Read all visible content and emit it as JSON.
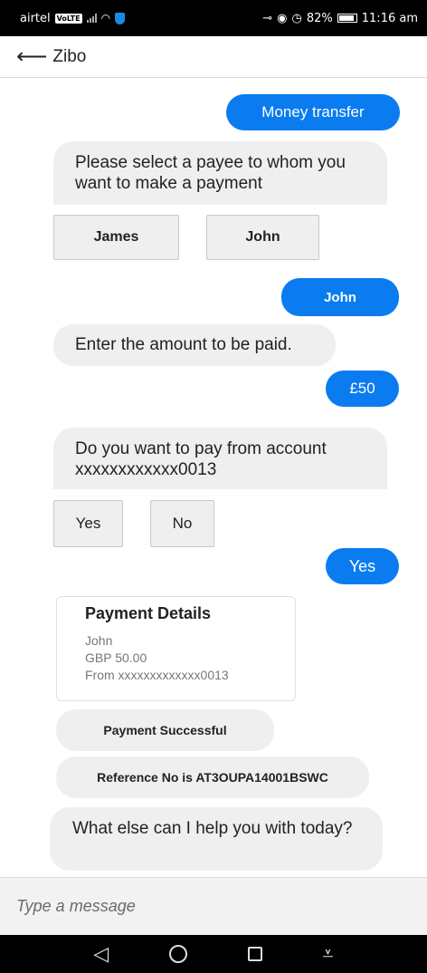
{
  "status_bar": {
    "carrier": "airtel",
    "volte": "VoLTE",
    "battery": "82%",
    "time": "11:16 am"
  },
  "header": {
    "back_icon": "arrow-left-icon",
    "title": "Zibo"
  },
  "chat": {
    "messages": [
      {
        "from": "user",
        "text": "Money transfer"
      },
      {
        "from": "bot",
        "text": "Please select a payee to whom you want to make a payment"
      },
      {
        "from": "bot_options",
        "options": [
          "James",
          "John"
        ]
      },
      {
        "from": "user",
        "text": "John"
      },
      {
        "from": "bot",
        "text": "Enter the amount to be paid."
      },
      {
        "from": "user",
        "text": "£50"
      },
      {
        "from": "bot",
        "text": "Do you want to pay from account xxxxxxxxxxxx0013"
      },
      {
        "from": "bot_options",
        "options": [
          "Yes",
          "No"
        ]
      },
      {
        "from": "user",
        "text": "Yes"
      },
      {
        "from": "card",
        "title": "Payment Details",
        "lines": [
          "John",
          "GBP 50.00",
          "From xxxxxxxxxxxxx0013"
        ]
      },
      {
        "from": "bot",
        "text": "Payment Successful"
      },
      {
        "from": "bot",
        "text": "Reference No is AT3OUPA14001BSWC"
      },
      {
        "from": "bot",
        "text": "What else can I help you with today?"
      }
    ]
  },
  "input": {
    "placeholder": "Type a message"
  },
  "colors": {
    "user_bubble": "#0a7cf0",
    "bot_bubble": "#efefef"
  }
}
